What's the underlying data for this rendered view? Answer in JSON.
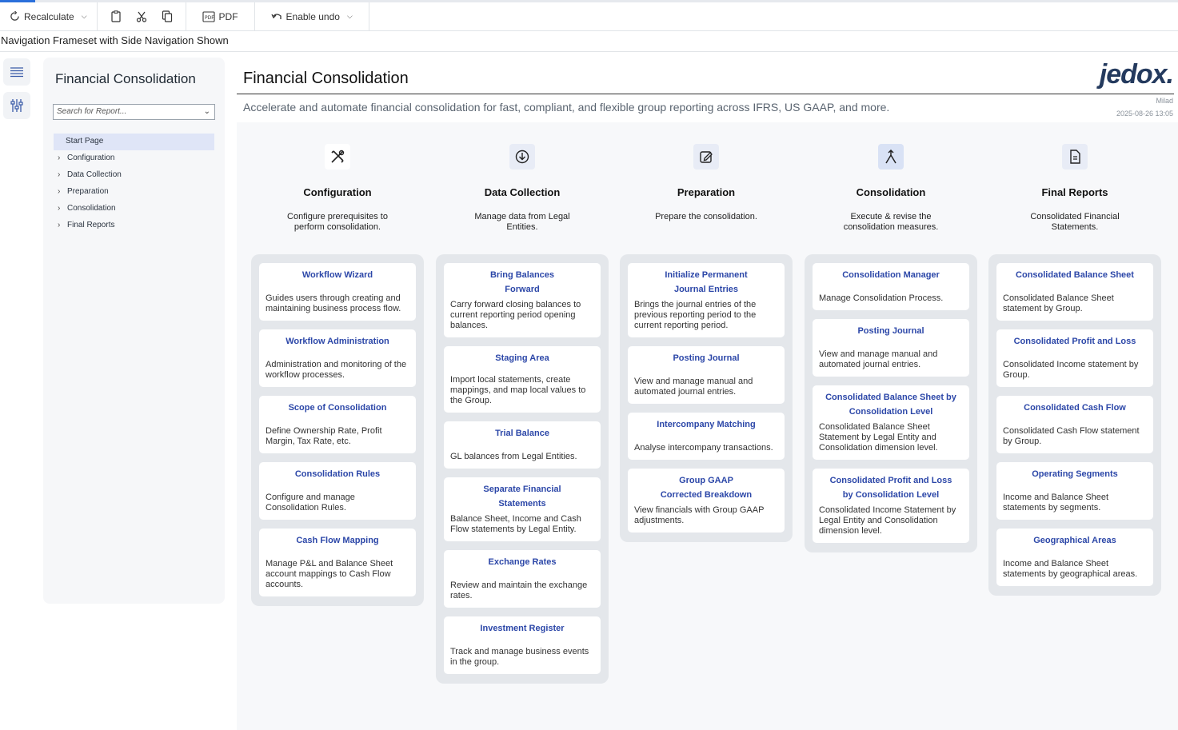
{
  "toolbar": {
    "recalculate": "Recalculate",
    "pdf": "PDF",
    "enable_undo": "Enable undo"
  },
  "window_title": "Navigation Frameset with Side Navigation Shown",
  "sidenav": {
    "title": "Financial Consolidation",
    "search_placeholder": "Search for Report...",
    "items": [
      {
        "label": "Start Page"
      },
      {
        "label": "Configuration"
      },
      {
        "label": "Data Collection"
      },
      {
        "label": "Preparation"
      },
      {
        "label": "Consolidation"
      },
      {
        "label": "Final Reports"
      }
    ]
  },
  "main": {
    "title": "Financial Consolidation",
    "subtitle": "Accelerate and automate financial consolidation for fast, compliant, and flexible group reporting across IFRS, US GAAP, and more.",
    "logo": "jedox.",
    "user": "Milad",
    "timestamp": "2025-08-26 13:05",
    "columns": [
      {
        "title": "Configuration",
        "icon": "tools-icon",
        "desc": "Configure prerequisites to perform consolidation.",
        "cards": [
          {
            "title": "Workflow Wizard",
            "desc": "Guides users through creating and maintaining business process flow."
          },
          {
            "title": "Workflow Administration",
            "desc": "Administration and monitoring of the workflow processes."
          },
          {
            "title": "Scope of Consolidation",
            "desc": "Define Ownership Rate, Profit Margin, Tax Rate, etc."
          },
          {
            "title": "Consolidation Rules",
            "desc": "Configure and manage Consolidation Rules."
          },
          {
            "title": "Cash Flow Mapping",
            "desc": "Manage P&L and Balance Sheet account mappings to Cash Flow accounts."
          }
        ]
      },
      {
        "title": "Data Collection",
        "icon": "download-icon",
        "desc": "Manage data from Legal Entities.",
        "cards": [
          {
            "title": "Bring Balances Forward",
            "desc": "Carry forward closing balances to current reporting period opening balances."
          },
          {
            "title": "Staging Area",
            "desc": "Import local statements, create mappings, and map local values to the Group."
          },
          {
            "title": "Trial Balance",
            "desc": "GL balances from Legal Entities."
          },
          {
            "title": "Separate Financial Statements",
            "desc": "Balance Sheet, Income and Cash Flow statements by Legal Entity."
          },
          {
            "title": "Exchange Rates",
            "desc": "Review and maintain the exchange rates."
          },
          {
            "title": "Investment Register",
            "desc": "Track and manage business events in the group."
          }
        ]
      },
      {
        "title": "Preparation",
        "icon": "edit-icon",
        "desc": "Prepare the consolidation.",
        "cards": [
          {
            "title": "Initialize Permanent Journal Entries",
            "desc": "Brings the journal entries of the previous reporting period to the current reporting period."
          },
          {
            "title": "Posting Journal",
            "desc": "View and manage manual and automated journal entries."
          },
          {
            "title": "Intercompany Matching",
            "desc": "Analyse intercompany transactions."
          },
          {
            "title": "Group GAAP Corrected Breakdown",
            "desc": "View financials with Group GAAP adjustments."
          }
        ]
      },
      {
        "title": "Consolidation",
        "icon": "merge-icon",
        "desc": "Execute & revise the consolidation measures.",
        "cards": [
          {
            "title": "Consolidation Manager",
            "desc": "Manage Consolidation Process."
          },
          {
            "title": "Posting Journal",
            "desc": "View and manage manual and automated journal entries."
          },
          {
            "title": "Consolidated Balance Sheet by Consolidation Level",
            "desc": "Consolidated Balance Sheet Statement by Legal Entity and Consolidation dimension level."
          },
          {
            "title": "Consolidated Profit and Loss by Consolidation Level",
            "desc": "Consolidated Income Statement by Legal Entity and Consolidation dimension level."
          }
        ]
      },
      {
        "title": "Final Reports",
        "icon": "document-icon",
        "desc": "Consolidated Financial Statements.",
        "cards": [
          {
            "title": "Consolidated Balance Sheet",
            "desc": "Consolidated Balance Sheet statement by Group."
          },
          {
            "title": "Consolidated Profit and Loss",
            "desc": "Consolidated Income statement by Group."
          },
          {
            "title": "Consolidated Cash Flow",
            "desc": "Consolidated Cash Flow statement by Group."
          },
          {
            "title": "Operating Segments",
            "desc": "Income and Balance Sheet statements by segments."
          },
          {
            "title": "Geographical Areas",
            "desc": "Income and Balance Sheet statements by geographical areas."
          }
        ]
      }
    ]
  }
}
